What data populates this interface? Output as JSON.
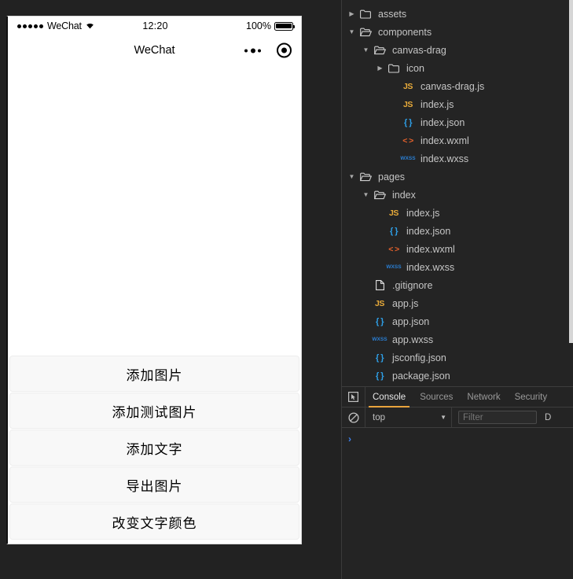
{
  "simulator": {
    "status_bar": {
      "carrier": "WeChat",
      "signal_icon": "signal-dots-icon",
      "wifi_icon": "wifi-icon",
      "time": "12:20",
      "battery_percent": "100%",
      "battery_icon": "battery-full-icon"
    },
    "nav": {
      "title": "WeChat",
      "menu_icon": "ellipsis-icon",
      "target_icon": "target-circle-icon"
    },
    "buttons": [
      {
        "label": "添加图片",
        "name": "add-image-button"
      },
      {
        "label": "添加测试图片",
        "name": "add-test-image-button"
      },
      {
        "label": "添加文字",
        "name": "add-text-button"
      },
      {
        "label": "导出图片",
        "name": "export-image-button"
      },
      {
        "label": "改变文字颜色",
        "name": "change-text-color-button"
      }
    ]
  },
  "file_tree": {
    "items": [
      {
        "label": "assets",
        "depth": 0,
        "kind": "folder",
        "expanded": false
      },
      {
        "label": "components",
        "depth": 0,
        "kind": "folder",
        "expanded": true
      },
      {
        "label": "canvas-drag",
        "depth": 1,
        "kind": "folder",
        "expanded": true
      },
      {
        "label": "icon",
        "depth": 2,
        "kind": "folder",
        "expanded": false
      },
      {
        "label": "canvas-drag.js",
        "depth": 3,
        "kind": "js"
      },
      {
        "label": "index.js",
        "depth": 3,
        "kind": "js"
      },
      {
        "label": "index.json",
        "depth": 3,
        "kind": "json"
      },
      {
        "label": "index.wxml",
        "depth": 3,
        "kind": "wxml"
      },
      {
        "label": "index.wxss",
        "depth": 3,
        "kind": "wxss"
      },
      {
        "label": "pages",
        "depth": 0,
        "kind": "folder",
        "expanded": true
      },
      {
        "label": "index",
        "depth": 1,
        "kind": "folder",
        "expanded": true
      },
      {
        "label": "index.js",
        "depth": 2,
        "kind": "js"
      },
      {
        "label": "index.json",
        "depth": 2,
        "kind": "json"
      },
      {
        "label": "index.wxml",
        "depth": 2,
        "kind": "wxml"
      },
      {
        "label": "index.wxss",
        "depth": 2,
        "kind": "wxss"
      },
      {
        "label": ".gitignore",
        "depth": 1,
        "kind": "file"
      },
      {
        "label": "app.js",
        "depth": 1,
        "kind": "js"
      },
      {
        "label": "app.json",
        "depth": 1,
        "kind": "json"
      },
      {
        "label": "app.wxss",
        "depth": 1,
        "kind": "wxss"
      },
      {
        "label": "jsconfig.json",
        "depth": 1,
        "kind": "json"
      },
      {
        "label": "package.json",
        "depth": 1,
        "kind": "json"
      }
    ],
    "icon_labels": {
      "js": "JS",
      "json": "{ }",
      "wxml": "< >",
      "wxss": "WXSS"
    }
  },
  "devtools": {
    "inspect_icon": "inspect-element-icon",
    "tabs": [
      {
        "label": "Console",
        "active": true
      },
      {
        "label": "Sources",
        "active": false
      },
      {
        "label": "Network",
        "active": false
      },
      {
        "label": "Security",
        "active": false
      }
    ],
    "clear_icon": "clear-console-icon",
    "context": "top",
    "context_caret_icon": "chevron-down-icon",
    "filter_placeholder": "Filter",
    "levels_label": "D",
    "prompt_caret": "›"
  },
  "colors": {
    "accent_tab": "#e8a33d",
    "prompt": "#3d82f0",
    "js_icon": "#e8ab3a",
    "json_icon": "#2ea0e8",
    "wxml_icon": "#e8622c",
    "wxss_icon": "#2a7fd4",
    "panel_bg": "#242424",
    "app_bg": "#222222"
  }
}
